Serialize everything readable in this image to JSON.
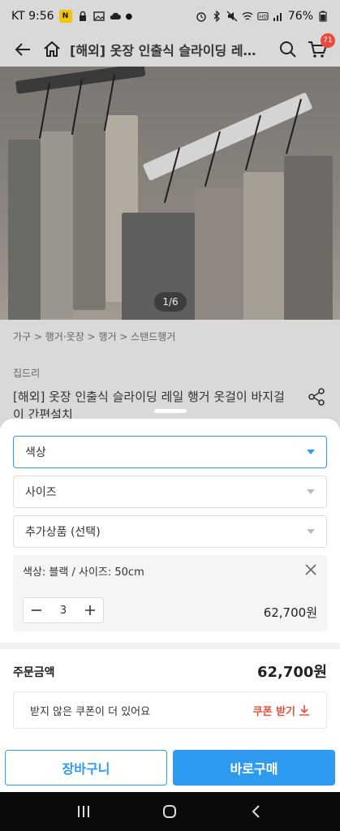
{
  "status_bar": {
    "carrier_time": "KT 9:56",
    "battery": "76%"
  },
  "app_bar": {
    "title": "[해외] 옷장 인출식 슬라이딩 레…",
    "cart_count": "71"
  },
  "gallery": {
    "counter": "1/6"
  },
  "page": {
    "breadcrumb": "가구 > 행거·옷장 > 행거 > 스탠드행거",
    "seller": "집드리",
    "product_title": "[해외] 옷장 인출식 슬라이딩 레일 행거 옷걸이 바지걸이 간편설치"
  },
  "sheet": {
    "color_select": "색상",
    "size_select": "사이즈",
    "extra_select": "추가상품 (선택)",
    "selected_option": {
      "label": "색상: 블랙 / 사이즈: 50cm",
      "quantity": "3",
      "price": "62,700원"
    },
    "total_label": "주문금액",
    "total_price": "62,700원",
    "coupon_text": "받지 않은 쿠폰이 더 있어요",
    "coupon_action": "쿠폰 받기",
    "cart_button": "장바구니",
    "buy_button": "바로구매"
  },
  "colors": {
    "accent": "#2e9bf0",
    "coupon_red": "#e94c3d",
    "dim_bg": "#d9d9d9"
  },
  "icons": [
    "back-arrow-icon",
    "home-icon",
    "search-icon",
    "cart-icon",
    "share-icon",
    "close-icon",
    "minus-icon",
    "plus-icon",
    "download-icon",
    "recents-icon",
    "home-nav-icon",
    "back-nav-icon"
  ]
}
